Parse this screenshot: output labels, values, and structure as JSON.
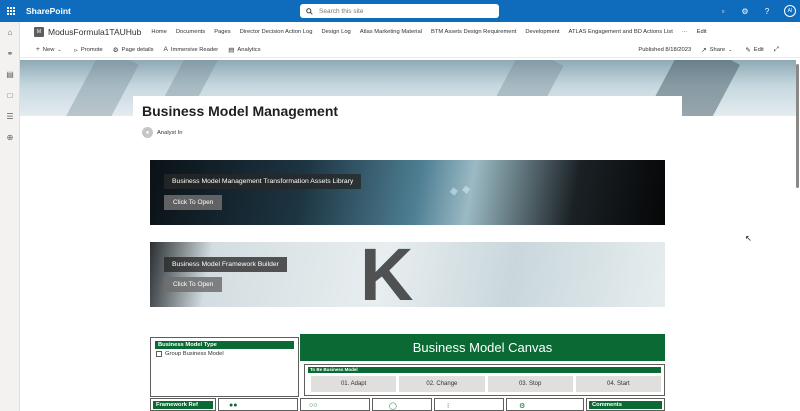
{
  "suite_bar": {
    "app_name": "SharePoint",
    "search_placeholder": "Search this site",
    "avatar_initials": "AI"
  },
  "site": {
    "logo_letter": "M",
    "title": "ModusFormula1TAUHub",
    "nav": [
      "Home",
      "Documents",
      "Pages",
      "Director Decision Action Log",
      "Design Log",
      "Atlas Marketing Material",
      "BTM Assets Design Requirement",
      "Development",
      "ATLAS Engagement and BD Actions List",
      "···",
      "Edit"
    ]
  },
  "command_bar": {
    "new": "New",
    "promote": "Promote",
    "page_details": "Page details",
    "immersive_reader": "Immersive Reader",
    "analytics": "Analytics",
    "published": "Published 8/18/2023",
    "share": "Share",
    "edit": "Edit"
  },
  "page": {
    "title": "Business Model Management",
    "author": "Analyst In"
  },
  "tiles": [
    {
      "label": "Business Model Management Transformation Assets Library",
      "button": "Click To Open"
    },
    {
      "label": "Business Model Framework Builder",
      "button": "Click To Open"
    }
  ],
  "canvas": {
    "type_header": "Business Model Type",
    "type_option": "Group Business Model",
    "title": "Business Model Canvas",
    "to_be_header": "To Be Business Model",
    "steps": [
      "01. Adapt",
      "02. Change",
      "03. Stop",
      "04. Start"
    ],
    "framework_ref": "Framework Ref",
    "comments": "Comments"
  },
  "colors": {
    "suite_bar": "#0f6cbd",
    "canvas_green": "#0b6a33"
  }
}
